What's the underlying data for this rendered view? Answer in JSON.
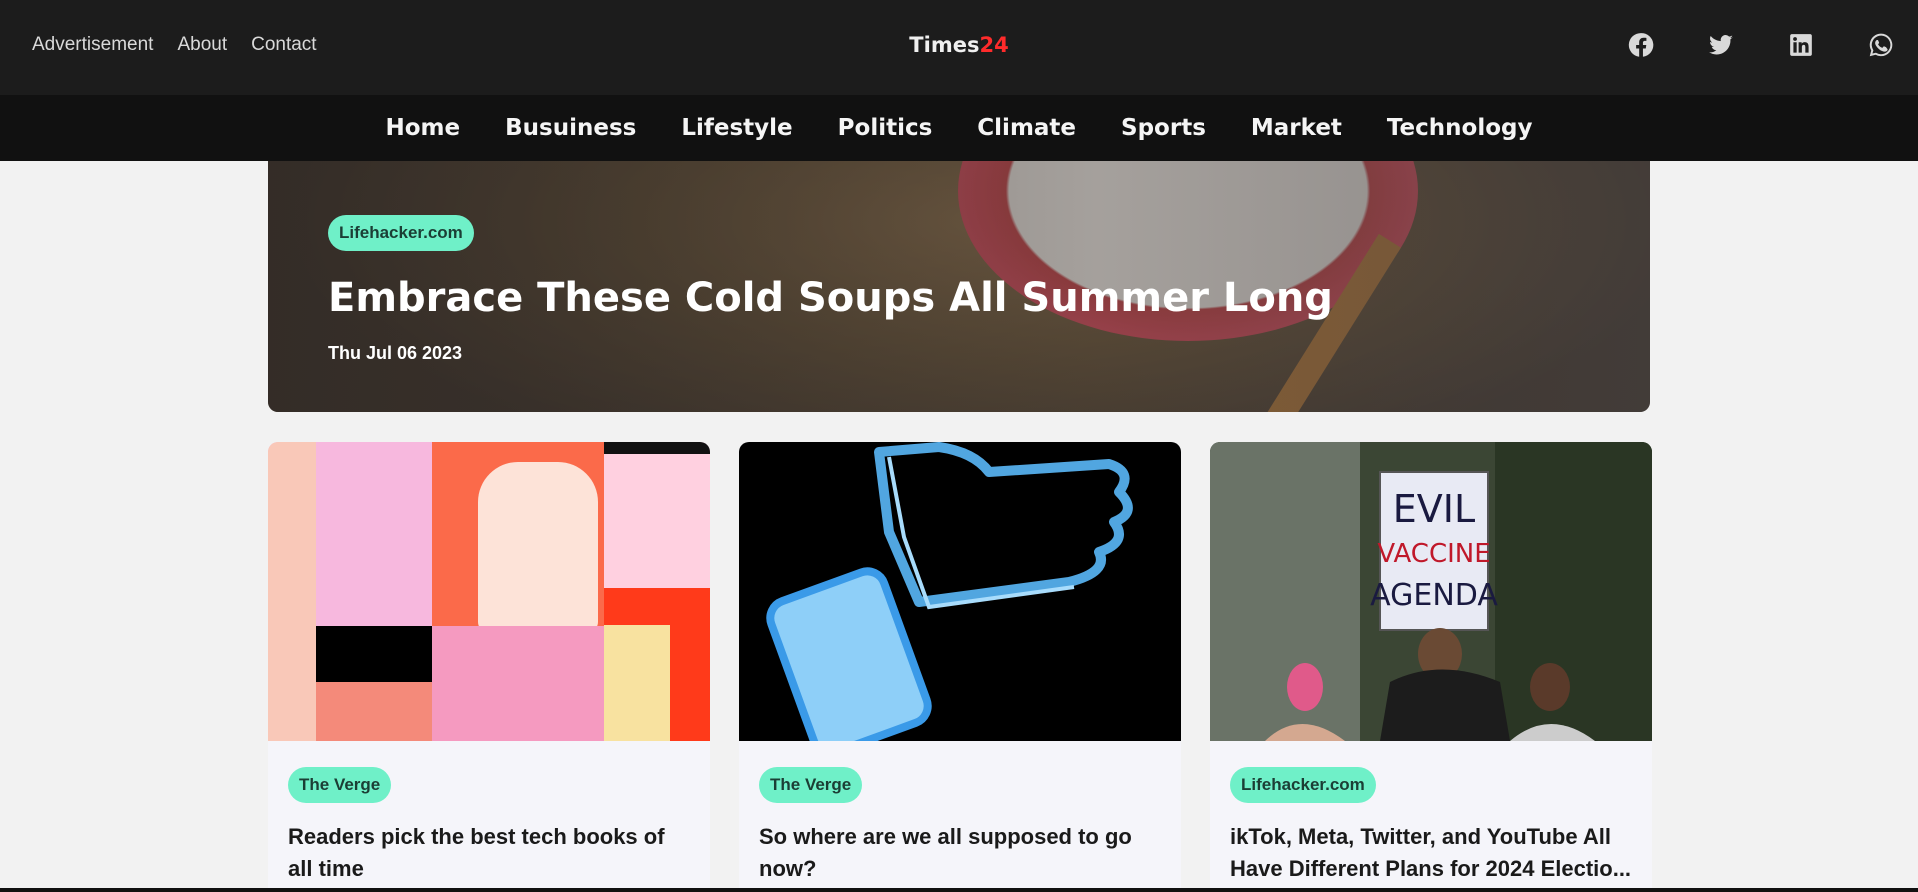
{
  "header": {
    "links": [
      "Advertisement",
      "About",
      "Contact"
    ],
    "logo_main": "Times",
    "logo_accent": "24",
    "accent_color": "#ff2b2b",
    "social_icons": [
      "facebook-icon",
      "twitter-icon",
      "linkedin-icon",
      "whatsapp-icon"
    ]
  },
  "nav": {
    "items": [
      "Home",
      "Busuiness",
      "Lifestyle",
      "Politics",
      "Climate",
      "Sports",
      "Market",
      "Technology"
    ]
  },
  "hero": {
    "source": "Lifehacker.com",
    "title": "Embrace These Cold Soups All Summer Long",
    "date": "Thu Jul 06 2023"
  },
  "cards": [
    {
      "source": "The Verge",
      "title": "Readers pick the best tech books of all time"
    },
    {
      "source": "The Verge",
      "title": "So where are we all supposed to go now?"
    },
    {
      "source": "Lifehacker.com",
      "title": "ikTok, Meta, Twitter, and YouTube All Have Different Plans for 2024 Electio..."
    }
  ],
  "sign": {
    "line1": "EVIL",
    "line2": "VACCINE",
    "line3": "AGENDA"
  },
  "colors": {
    "badge": "#6ff0c8",
    "header_bg": "#1c1c1c",
    "nav_bg": "#111111"
  }
}
